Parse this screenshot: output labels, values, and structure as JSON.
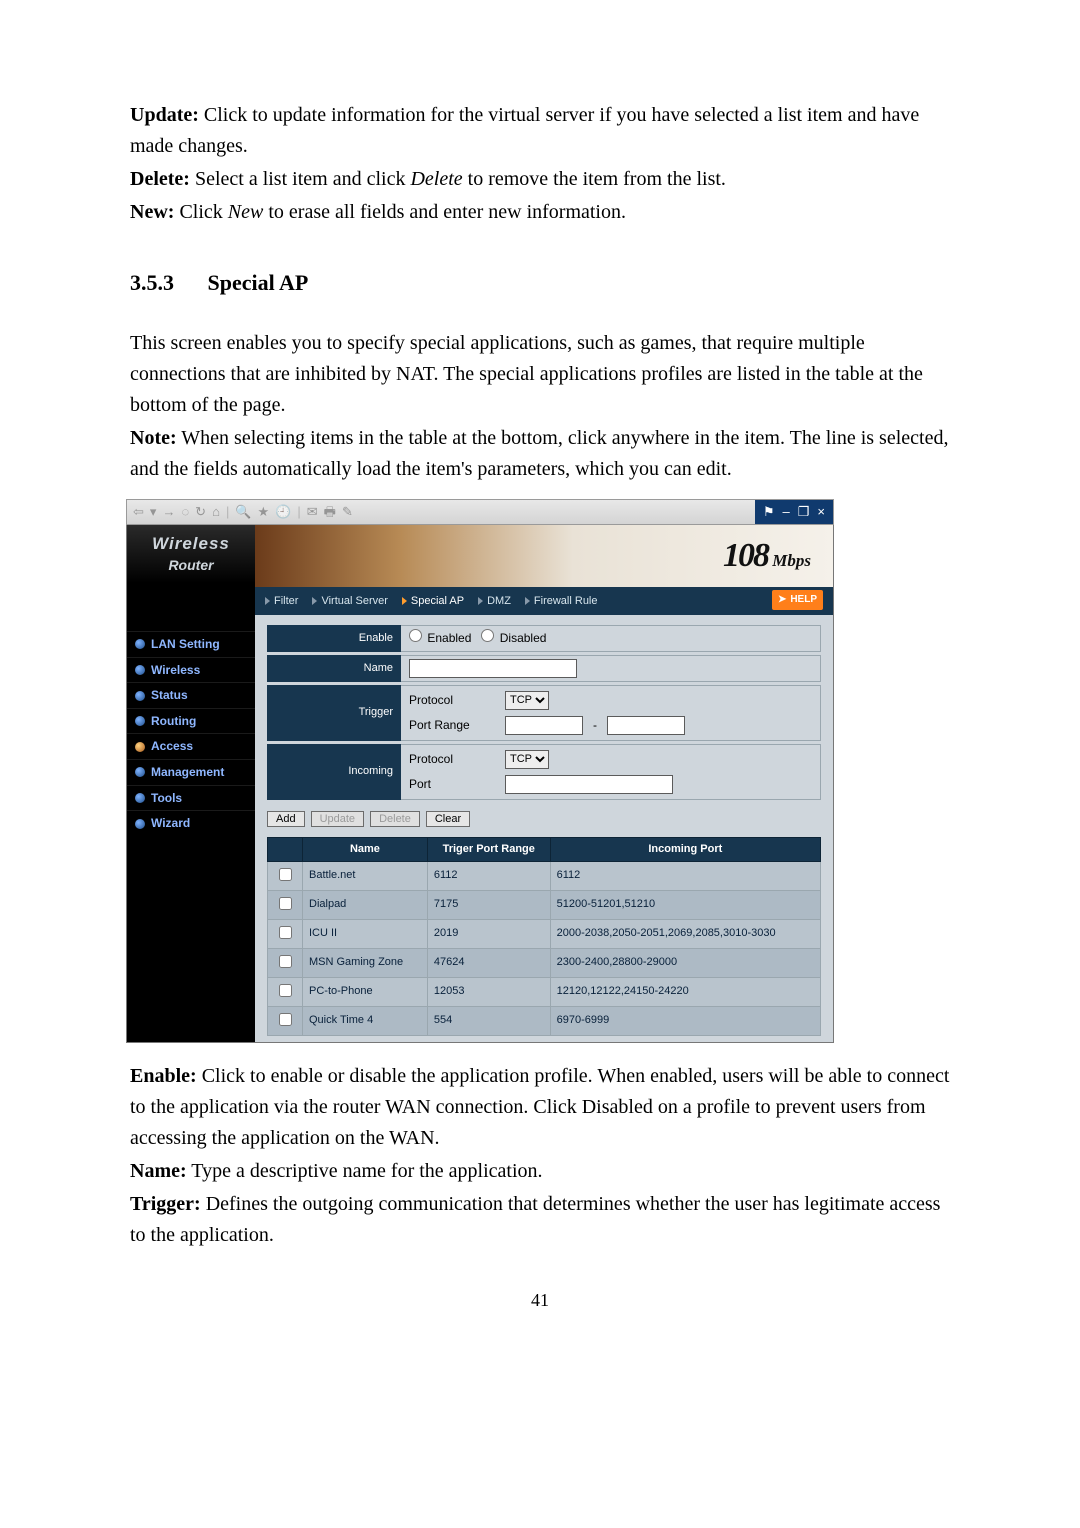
{
  "intro_paragraphs": [
    {
      "label": "Update:",
      "text": " Click to update information for the virtual server if you have selected a list item and have made changes."
    },
    {
      "label": "Delete:",
      "text_pre": " Select a list item and click ",
      "italic": "Delete",
      "text_post": " to remove the item from the list."
    },
    {
      "label": "New:",
      "text_pre": " Click ",
      "italic": "New",
      "text_post": " to erase all fields and enter new information."
    }
  ],
  "section": {
    "number": "3.5.3",
    "title": "Special AP"
  },
  "body_paragraphs": [
    "This screen enables you to specify special applications, such as games, that require multiple connections that are inhibited by NAT.    The special applications profiles are listed in the table at the bottom of the page.",
    {
      "label": "Note:",
      "text": " When selecting items in the table at the bottom, click anywhere in the item. The line is selected, and the fields automatically load the item's parameters, which you can edit."
    }
  ],
  "ie_window_controls": {
    "minimize": "–",
    "maximize": "❐",
    "close": "×"
  },
  "side_logo": {
    "line1": "Wireless",
    "line2": "Router"
  },
  "side_menu": [
    "LAN Setting",
    "Wireless",
    "Status",
    "Routing",
    "Access",
    "Management",
    "Tools",
    "Wizard"
  ],
  "banner": {
    "big": "108",
    "unit": "Mbps"
  },
  "subnav": [
    "Filter",
    "Virtual Server",
    "Special AP",
    "DMZ",
    "Firewall Rule"
  ],
  "help_label": "HELP",
  "form": {
    "enable_label": "Enable",
    "enable_opts": [
      "Enabled",
      "Disabled"
    ],
    "name_label": "Name",
    "trigger_label": "Trigger",
    "incoming_label": "Incoming",
    "protocol_label": "Protocol",
    "portrange_label": "Port Range",
    "port_label": "Port",
    "protocol_value": "TCP",
    "portrange_sep": "-",
    "buttons": {
      "add": "Add",
      "update": "Update",
      "delete": "Delete",
      "clear": "Clear"
    }
  },
  "table": {
    "headers": [
      "",
      "Name",
      "Triger Port Range",
      "Incoming Port"
    ],
    "rows": [
      {
        "name": "Battle.net",
        "trigger": "6112",
        "incoming": "6112"
      },
      {
        "name": "Dialpad",
        "trigger": "7175",
        "incoming": "51200-51201,51210"
      },
      {
        "name": "ICU II",
        "trigger": "2019",
        "incoming": "2000-2038,2050-2051,2069,2085,3010-3030"
      },
      {
        "name": "MSN Gaming Zone",
        "trigger": "47624",
        "incoming": "2300-2400,28800-29000"
      },
      {
        "name": "PC-to-Phone",
        "trigger": "12053",
        "incoming": "12120,12122,24150-24220"
      },
      {
        "name": "Quick Time 4",
        "trigger": "554",
        "incoming": "6970-6999"
      }
    ]
  },
  "post_paragraphs": [
    {
      "label": "Enable:",
      "text": " Click to enable or disable the application profile. When enabled, users will be able to connect to the application via the router WAN connection. Click Disabled on a profile to prevent users from accessing the application on the WAN."
    },
    {
      "label": "Name:",
      "text": " Type a descriptive name for the application."
    },
    {
      "label": "Trigger:",
      "text": " Defines the outgoing communication that determines whether the user has legitimate access to the application."
    }
  ],
  "page_number": "41"
}
